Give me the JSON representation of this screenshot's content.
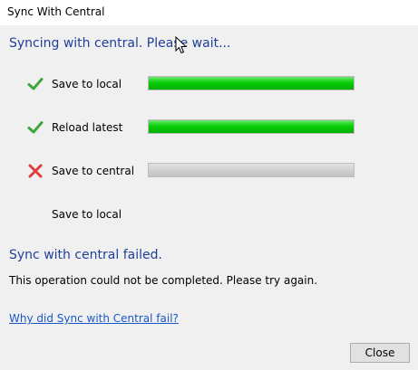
{
  "window": {
    "title": "Sync With Central"
  },
  "status": {
    "heading": "Syncing with central. Please wait..."
  },
  "steps": [
    {
      "label": "Save to local",
      "icon": "green-check-icon",
      "progress": 1.0
    },
    {
      "label": "Reload latest",
      "icon": "green-check-icon",
      "progress": 1.0
    },
    {
      "label": "Save to central",
      "icon": "red-x-icon",
      "progress": 0.0
    },
    {
      "label": "Save to local",
      "icon": "",
      "progress": null
    }
  ],
  "result": {
    "title": "Sync with central failed.",
    "message": "This operation could not be completed. Please try again."
  },
  "help_link": "Why did Sync with Central fail?",
  "buttons": {
    "close": "Close"
  },
  "colors": {
    "heading": "#1f3f99",
    "link": "#1a58c8",
    "progress_fill": "#06d006",
    "check": "#3fa53f",
    "error_x": "#e03c3c"
  }
}
